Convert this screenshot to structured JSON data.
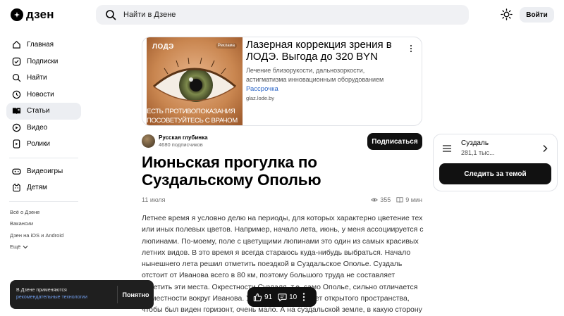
{
  "header": {
    "logo_text": "дзен",
    "search_placeholder": "Найти в Дзене",
    "login_label": "Войти"
  },
  "sidebar": {
    "items": [
      {
        "label": "Главная",
        "icon": "home-icon"
      },
      {
        "label": "Подписки",
        "icon": "subscriptions-icon"
      },
      {
        "label": "Найти",
        "icon": "search-icon"
      },
      {
        "label": "Новости",
        "icon": "news-icon"
      },
      {
        "label": "Статьи",
        "icon": "articles-icon",
        "active": true
      },
      {
        "label": "Видео",
        "icon": "video-icon"
      },
      {
        "label": "Ролики",
        "icon": "shorts-icon"
      }
    ],
    "items2": [
      {
        "label": "Видеоигры",
        "icon": "gamepad-icon"
      },
      {
        "label": "Детям",
        "icon": "kids-icon"
      }
    ],
    "footer_links": [
      "Всё о Дзене",
      "Вакансии",
      "Дзен на iOS и Android"
    ],
    "more_label": "Ещё"
  },
  "ad": {
    "brand": "ЛОДЭ",
    "badge": "Реклама",
    "slogan": "ЕСТЬ ПРОТИВОПОКАЗАНИЯ ПОСОВЕТУЙТЕСЬ С ВРАЧОМ",
    "title": "Лазерная коррекция зрения в ЛОДЭ. Выгода до 320 BYN",
    "description": "Лечение близорукости, дальнозоркости, астигматизма инновационным оборудованием",
    "link": "Рассрочка",
    "domain": "glaz.lode.by"
  },
  "channel": {
    "name": "Русская глубинка",
    "subscribers": "4680 подписчиков",
    "subscribe_label": "Подписаться"
  },
  "article": {
    "title": "Июньская прогулка по Суздальскому Ополью",
    "date": "11 июля",
    "views": "355",
    "read_time": "9 мин",
    "body": "Летнее время я условно делю на периоды, для которых характерно цветение тех или иных полевых цветов. Например, начало лета, июнь, у меня ассоциируется с люпинами. По-моему, поле с цветущими люпинами это один из самых красивых летних видов. В это время я всегда стараюсь куда-нибудь выбраться. Начало нынешнего лета решил отметить поездкой в Суздальское Ополье. Суздаль отстоит от Иванова всего в 80 км, поэтому большого труда не составляет посетить эти места. Окрестности Суздаля, т.е. само Ополье, сильно отличается от местности вокруг Иванова. У нас практически нет открытого пространства, чтобы был виден горизонт, очень мало. А на суздальской земле, в какую сторону ни"
  },
  "topic": {
    "name": "Суздаль",
    "count": "281,1 тыс...",
    "follow_label": "Следить за темой"
  },
  "cookie": {
    "text": "В Дзене применяются",
    "link": "рекомендательные технологии",
    "button": "Понятно"
  },
  "actions": {
    "likes": "91",
    "comments": "10"
  }
}
